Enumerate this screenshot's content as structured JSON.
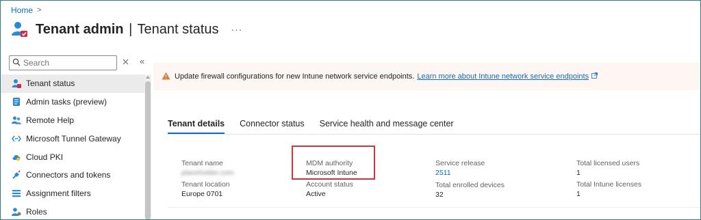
{
  "breadcrumb": {
    "home": "Home",
    "separator": ">"
  },
  "header": {
    "title_bold": "Tenant admin",
    "title_sep": "|",
    "title_rest": "Tenant status",
    "more": "···"
  },
  "search": {
    "placeholder": "Search"
  },
  "sidebar": {
    "items": [
      {
        "label": "Tenant status",
        "icon": "tenant-status-icon"
      },
      {
        "label": "Admin tasks (preview)",
        "icon": "admin-tasks-icon"
      },
      {
        "label": "Remote Help",
        "icon": "remote-help-icon"
      },
      {
        "label": "Microsoft Tunnel Gateway",
        "icon": "tunnel-gateway-icon"
      },
      {
        "label": "Cloud PKI",
        "icon": "cloud-pki-icon"
      },
      {
        "label": "Connectors and tokens",
        "icon": "connectors-icon"
      },
      {
        "label": "Assignment filters",
        "icon": "filters-icon"
      },
      {
        "label": "Roles",
        "icon": "roles-icon"
      }
    ]
  },
  "banner": {
    "text": "Update firewall configurations for new Intune network service endpoints.",
    "link": "Learn more about Intune network service endpoints"
  },
  "tabs": [
    {
      "label": "Tenant details",
      "active": true
    },
    {
      "label": "Connector status",
      "active": false
    },
    {
      "label": "Service health and message center",
      "active": false
    }
  ],
  "details": {
    "tenant_name_label": "Tenant name",
    "tenant_name_value": "placeholder.com",
    "tenant_location_label": "Tenant location",
    "tenant_location_value": "Europe 0701",
    "mdm_authority_label": "MDM authority",
    "mdm_authority_value": "Microsoft Intune",
    "account_status_label": "Account status",
    "account_status_value": "Active",
    "service_release_label": "Service release",
    "service_release_value": "2511",
    "total_enrolled_label": "Total enrolled devices",
    "total_enrolled_value": "32",
    "total_licensed_users_label": "Total licensed users",
    "total_licensed_users_value": "1",
    "total_intune_licenses_label": "Total Intune licenses",
    "total_intune_licenses_value": "1"
  },
  "colors": {
    "accent": "#0f6cbd",
    "highlight": "#d13438",
    "warning": "#d67f3c"
  }
}
